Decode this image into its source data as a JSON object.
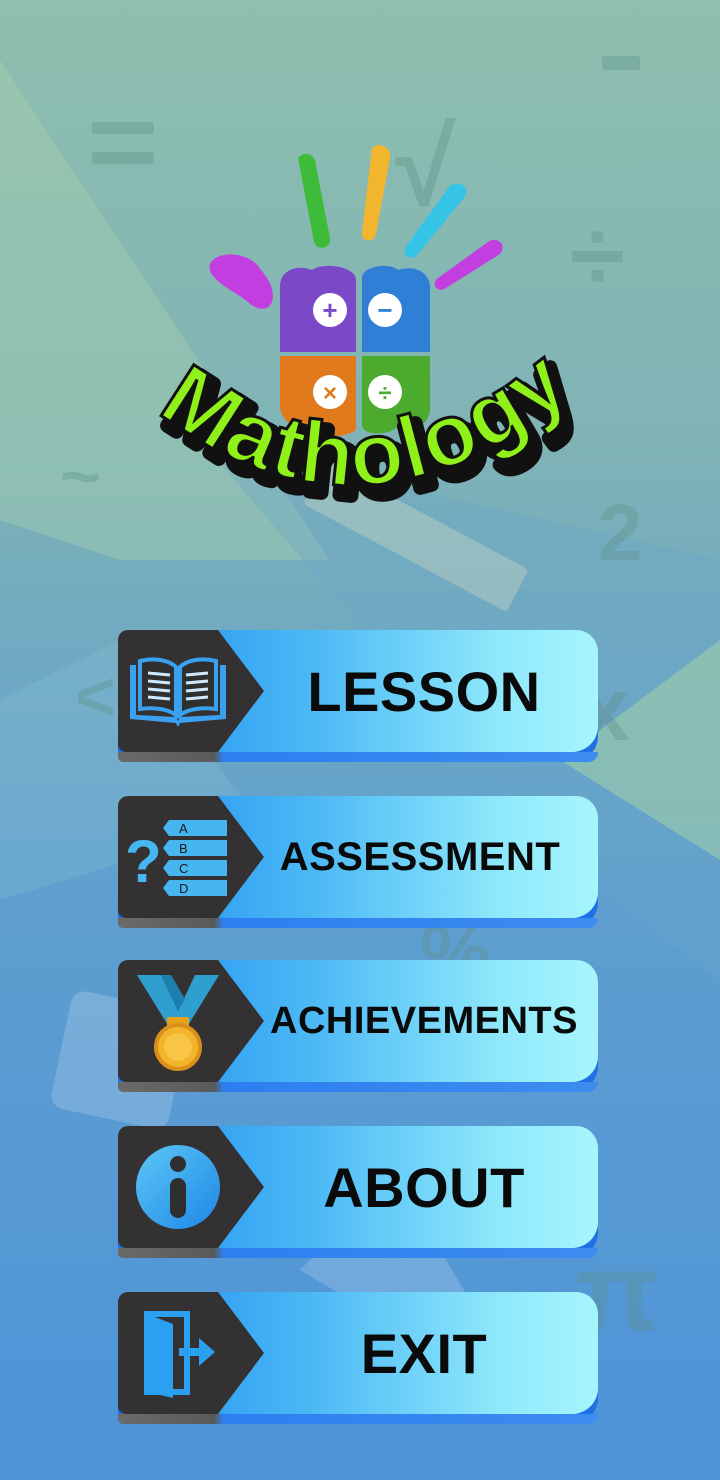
{
  "app": {
    "logo_text": "Mathology",
    "operators": [
      "+",
      "−",
      "×",
      "÷"
    ]
  },
  "menu": {
    "items": [
      {
        "label": "LESSON",
        "icon": "book-icon"
      },
      {
        "label": "ASSESSMENT",
        "icon": "quiz-options-icon"
      },
      {
        "label": "ACHIEVEMENTS",
        "icon": "medal-icon"
      },
      {
        "label": "ABOUT",
        "icon": "info-icon"
      },
      {
        "label": "EXIT",
        "icon": "exit-door-icon"
      }
    ],
    "quiz_letters": [
      "A",
      "B",
      "C",
      "D"
    ]
  },
  "colors": {
    "button_left": "#1e8ef0",
    "button_right": "#a6f5fc",
    "icon_plate": "#333132",
    "logo_green": "#8ff01a",
    "petal_purple": "#7b49c8",
    "petal_blue": "#2f7fd6",
    "petal_orange": "#e07a1d",
    "petal_green": "#4caa2c"
  }
}
